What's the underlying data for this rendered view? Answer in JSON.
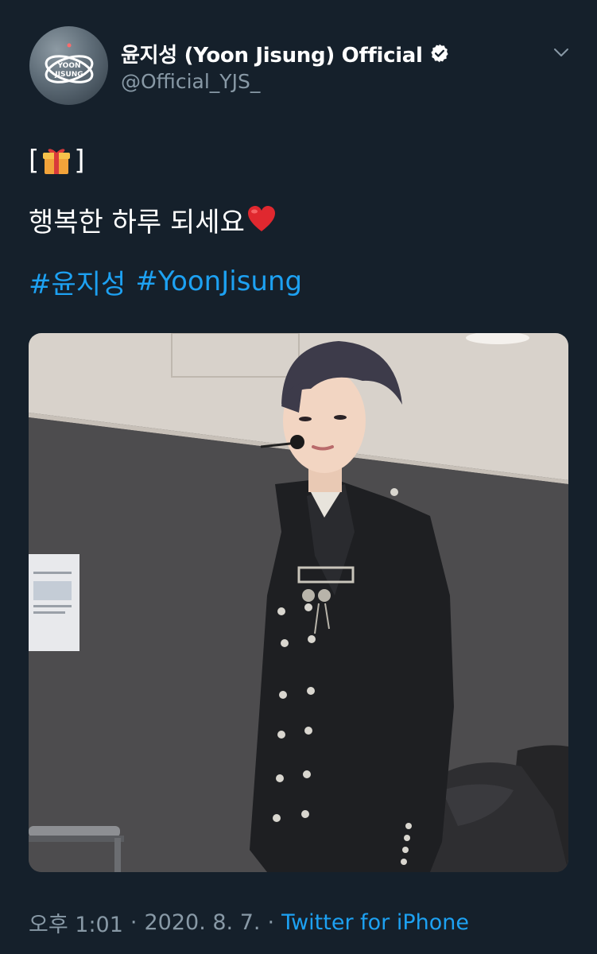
{
  "author": {
    "display_name": "윤지성 (Yoon Jisung) Official",
    "handle": "@Official_YJS_",
    "avatar_text_line1": "YOON",
    "avatar_text_line2": "JISUNG",
    "verified": true
  },
  "tweet": {
    "gift_line_open": "[",
    "gift_line_close": "]",
    "gift_icon": "wrapped-gift-emoji",
    "message": "행복한 하루 되세요",
    "heart_icon": "red-heart-emoji",
    "hashtags": [
      "#윤지성",
      "#YoonJisung"
    ]
  },
  "media": {
    "type": "photo"
  },
  "footer": {
    "time": "오후 1:01",
    "separator": "·",
    "date": "2020. 8. 7.",
    "source": "Twitter for iPhone"
  },
  "colors": {
    "background": "#15202b",
    "link": "#1da1f2",
    "secondary_text": "#8899a6",
    "primary_text": "#ffffff"
  }
}
